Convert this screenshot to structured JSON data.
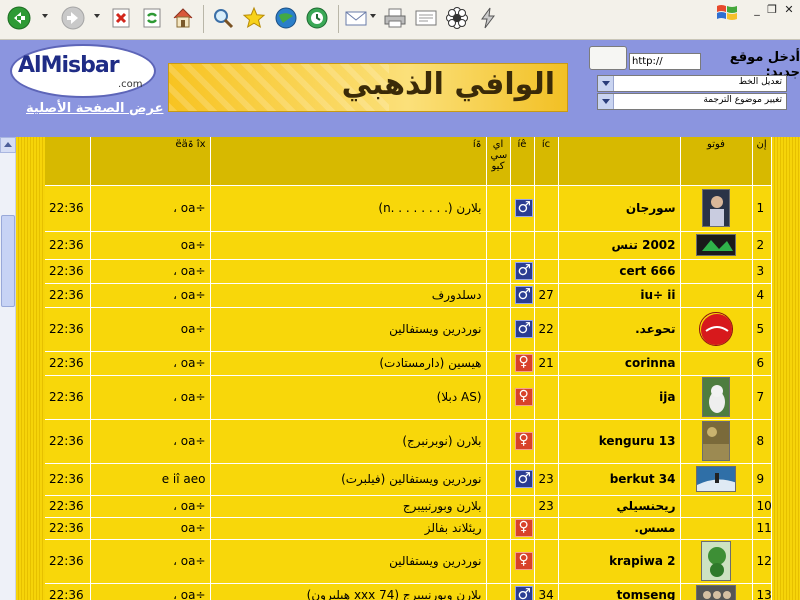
{
  "toolbar": {
    "icons": [
      "back-icon",
      "forward-icon",
      "stop-icon",
      "refresh-icon",
      "home-icon",
      "search-icon",
      "favorites-icon",
      "media-icon",
      "history-icon",
      "mail-icon",
      "print-icon",
      "edit-icon",
      "flower-icon",
      "bolt-icon"
    ]
  },
  "banner": {
    "logo_text": "AlMisbar",
    "logo_com": ".com",
    "original_page_link": "عرض الصفحة الأصلية",
    "ad_text": "الوافي الذهبي",
    "enter_site_label": "أدخل موقع جديد:",
    "url_value": "http://",
    "select_1": "تعديل الخط",
    "select_2": "تغيير موضوع الترجمة"
  },
  "table": {
    "headers": {
      "number": "إن",
      "photo": "فوتو",
      "name": "",
      "age": "íc",
      "gender": "íê",
      "icq": "اي سي كيو",
      "location": "íۃ",
      "status": "ëäۃ îx",
      "time": ""
    },
    "rows": [
      {
        "num": "1",
        "photo": "photo-person",
        "name": "سورجان",
        "age": "",
        "gender": "male",
        "location": "بلارن (. . . . . . . .n)",
        "status": "، oa÷",
        "time": "22:36"
      },
      {
        "num": "2",
        "photo": "photo-logo",
        "name": "2002 تنس",
        "age": "",
        "gender": "",
        "location": "",
        "status": "oa÷",
        "time": "22:36"
      },
      {
        "num": "3",
        "photo": "",
        "name": "cert 666",
        "age": "",
        "gender": "male",
        "location": "",
        "status": "، oa÷",
        "time": "22:36"
      },
      {
        "num": "4",
        "photo": "",
        "name": "iu÷ ii",
        "age": "27",
        "gender": "male",
        "location": "دسلدورف",
        "status": "، oa÷",
        "time": "22:36"
      },
      {
        "num": "5",
        "photo": "photo-cola",
        "name": "تحوعد.",
        "age": "22",
        "gender": "male",
        "location": "نوردرين ويستفالين",
        "status": "oa÷",
        "time": "22:36"
      },
      {
        "num": "6",
        "photo": "",
        "name": "corinna",
        "age": "21",
        "gender": "female",
        "location": "هيسين (دارمستادت)",
        "status": "، oa÷",
        "time": "22:36"
      },
      {
        "num": "7",
        "photo": "photo-cat",
        "name": "ija",
        "age": "",
        "gender": "female",
        "location": "(AS دبلا)",
        "status": "، oa÷",
        "time": "22:36"
      },
      {
        "num": "8",
        "photo": "photo-nature",
        "name": "kenguru 13",
        "age": "",
        "gender": "female",
        "location": "بلارن (نوبرنبرج)",
        "status": "، oa÷",
        "time": "22:36"
      },
      {
        "num": "9",
        "photo": "photo-surf",
        "name": "berkut 34",
        "age": "23",
        "gender": "male",
        "location": "نوردرين ويستفالين (فيلبرت)",
        "status": "e iî aeo",
        "time": "22:36"
      },
      {
        "num": "10",
        "photo": "",
        "name": "ريحنسيلي",
        "age": "23",
        "gender": "",
        "location": "بلارن وبورنبيبرج",
        "status": "، oa÷",
        "time": "22:36"
      },
      {
        "num": "11",
        "photo": "",
        "name": "مسس.",
        "age": "",
        "gender": "female",
        "location": "ريئلاند بفالز",
        "status": "oa÷",
        "time": "22:36"
      },
      {
        "num": "12",
        "photo": "photo-plant",
        "name": "krapiwa 2",
        "age": "",
        "gender": "female",
        "location": "نوردرين ويستفالين",
        "status": "، oa÷",
        "time": "22:36"
      },
      {
        "num": "13",
        "photo": "photo-group",
        "name": "tomseng",
        "age": "34",
        "gender": "male",
        "location": "بلارن وبورنبيبرج (74 xxx هيلبرون)",
        "status": "، oa÷",
        "time": "22:36"
      }
    ]
  }
}
